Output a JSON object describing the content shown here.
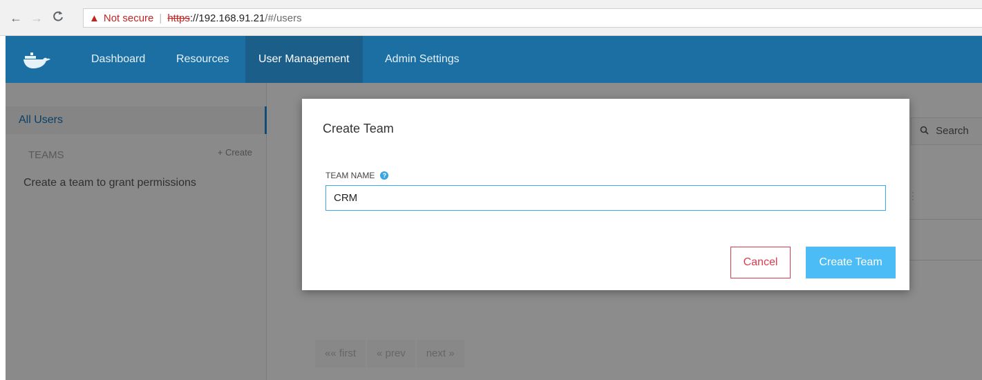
{
  "browser": {
    "back_icon": "←",
    "forward_icon": "→",
    "reload_icon": "C",
    "security_warning": "Not secure",
    "url_scheme": "https",
    "url_host": "://192.168.91.21",
    "url_path": "/#/users"
  },
  "appbar": {
    "logo_icon": "docker-whale-icon",
    "nav": [
      {
        "label": "Dashboard"
      },
      {
        "label": "Resources"
      },
      {
        "label": "User Management"
      },
      {
        "label": "Admin Settings"
      }
    ],
    "active": "User Management"
  },
  "sidebar": {
    "all_users": "All Users",
    "teams_heading": "TEAMS",
    "create_link": "+ Create",
    "empty_hint": "Create a team to grant permissions"
  },
  "main": {
    "search_placeholder": "Search",
    "pager": [
      "«« first",
      "« prev",
      "next »"
    ]
  },
  "modal": {
    "title": "Create Team",
    "field_label": "TEAM NAME",
    "field_value": "CRM",
    "cancel_label": "Cancel",
    "submit_label": "Create Team"
  },
  "colors": {
    "appbar": "#1b6fa3",
    "primary_button": "#4bbcf5",
    "danger": "#dc3b4b"
  }
}
